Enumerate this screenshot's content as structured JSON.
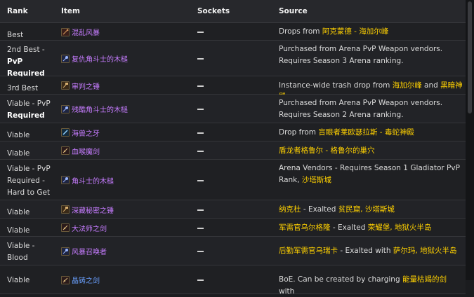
{
  "headers": {
    "rank": "Rank",
    "item": "Item",
    "sockets": "Sockets",
    "source": "Source"
  },
  "rows": [
    {
      "rank": "Best",
      "item": "混乱风暴",
      "quality": "epic",
      "icon": "axe-icon",
      "source": [
        {
          "t": "Drops from "
        },
        {
          "t": "阿克蒙德 - 海加尔峰",
          "hl": true
        }
      ]
    },
    {
      "rank_parts": [
        "2nd Best -",
        "PvP",
        "Required"
      ],
      "item": "复仇角斗士的木槌",
      "quality": "epic",
      "icon": "mace-icon",
      "source": [
        {
          "t": "Purchased from Arena PvP Weapon vendors. Requires Season 3 Arena ranking."
        }
      ]
    },
    {
      "rank": "3rd Best",
      "item": "审判之锤",
      "quality": "epic",
      "icon": "hammer-icon",
      "source": [
        {
          "t": "Instance-wide trash drop from "
        },
        {
          "t": "海加尔峰",
          "hl": true
        },
        {
          "t": " and "
        },
        {
          "t": "黑暗神殿",
          "hl": true
        }
      ]
    },
    {
      "rank_parts": [
        "Viable - PvP",
        "Required"
      ],
      "item": "残酷角斗士的木槌",
      "quality": "epic",
      "icon": "mace-icon",
      "source": [
        {
          "t": "Purchased from Arena PvP Weapon vendors. Requires Season 2 Arena ranking."
        }
      ]
    },
    {
      "rank": "Viable",
      "item": "海兽之牙",
      "quality": "epic",
      "icon": "dagger-icon",
      "source": [
        {
          "t": "Drop from "
        },
        {
          "t": "盲眼者莱欧瑟拉斯 - 毒蛇神殿",
          "hl": true
        }
      ]
    },
    {
      "rank": "Viable",
      "item": "血喉魔剑",
      "quality": "epic",
      "icon": "sword-icon",
      "source": [
        {
          "t": "盾龙者格鲁尔 - 格鲁尔的巢穴",
          "hl": true
        }
      ]
    },
    {
      "rank": "Viable - PvP Required - Hard to Get",
      "item": "角斗士的木槌",
      "quality": "epic",
      "icon": "mace-icon",
      "source": [
        {
          "t": "Arena Vendors - Requires Season 1 Gladiator PvP Rank, "
        },
        {
          "t": "沙塔斯城",
          "hl": true
        }
      ]
    },
    {
      "rank": "Viable",
      "item": "深藏秘密之锤",
      "quality": "epic",
      "icon": "hammer-icon",
      "source": [
        {
          "t": "纳克杜",
          "hl": true
        },
        {
          "t": " - Exalted "
        },
        {
          "t": "贫民窟, 沙塔斯城",
          "hl": true
        }
      ]
    },
    {
      "rank": "Viable",
      "item": "大法师之剑",
      "quality": "epic",
      "icon": "sword-icon",
      "source": [
        {
          "t": "军需官乌尔格隆",
          "hl": true
        },
        {
          "t": " - Exalted "
        },
        {
          "t": "荣耀堡, 地狱火半岛",
          "hl": true
        }
      ]
    },
    {
      "rank_parts": [
        "Viable -",
        "Blood"
      ],
      "item": "风暴召唤者",
      "quality": "epic",
      "icon": "mace-icon",
      "source": [
        {
          "t": "后勤军需官乌瑞卡",
          "hl": true
        },
        {
          "t": " - Exalted with "
        },
        {
          "t": "萨尔玛, 地狱火半岛",
          "hl": true
        }
      ]
    },
    {
      "rank": "Viable",
      "item": "晶铸之剑",
      "quality": "rare",
      "icon": "sword-icon",
      "source": [
        {
          "t": "BoE. Can be created by charging "
        },
        {
          "t": "能量枯竭的剑",
          "hl": true
        },
        {
          "t": " with"
        }
      ]
    }
  ],
  "colors": {
    "accent": "#ffd100",
    "epic": "#c67cff",
    "rare": "#6aa0ff",
    "bg": "#1b1c1f"
  }
}
